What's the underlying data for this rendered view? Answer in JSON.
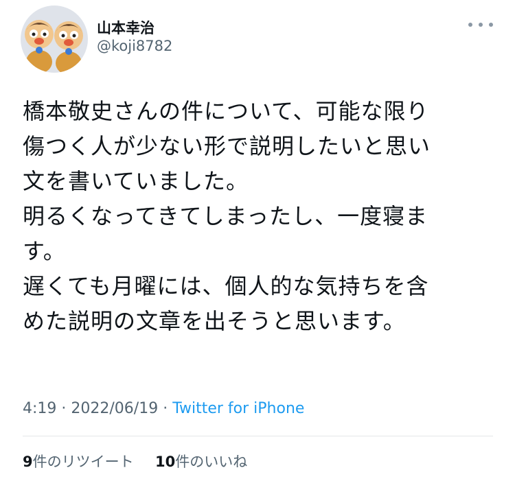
{
  "author": {
    "display_name": "山本幸治",
    "handle": "@koji8782",
    "avatar_icon": "avatar-figurines-icon"
  },
  "more_icon": "more-horizontal-icon",
  "tweet": {
    "lines": [
      "橋本敬史さんの件について、可能な限り",
      "傷つく人が少ない形で説明したいと思い",
      "文を書いていました。",
      "明るくなってきてしまったし、一度寝ま",
      "す。",
      "遅くても月曜には、個人的な気持ちを含",
      "めた説明の文章を出そうと思います。"
    ]
  },
  "meta": {
    "time": "4:19",
    "separator1": " · ",
    "date": "2022/06/19",
    "separator2": " · ",
    "source": "Twitter for iPhone"
  },
  "stats": {
    "retweets_count": "9",
    "retweets_label": "件のリツイート",
    "likes_count": "10",
    "likes_label": "件のいいね"
  },
  "colors": {
    "text": "#0f1419",
    "secondary": "#536471",
    "link": "#1d9bf0",
    "divider": "#e3e6e8"
  }
}
